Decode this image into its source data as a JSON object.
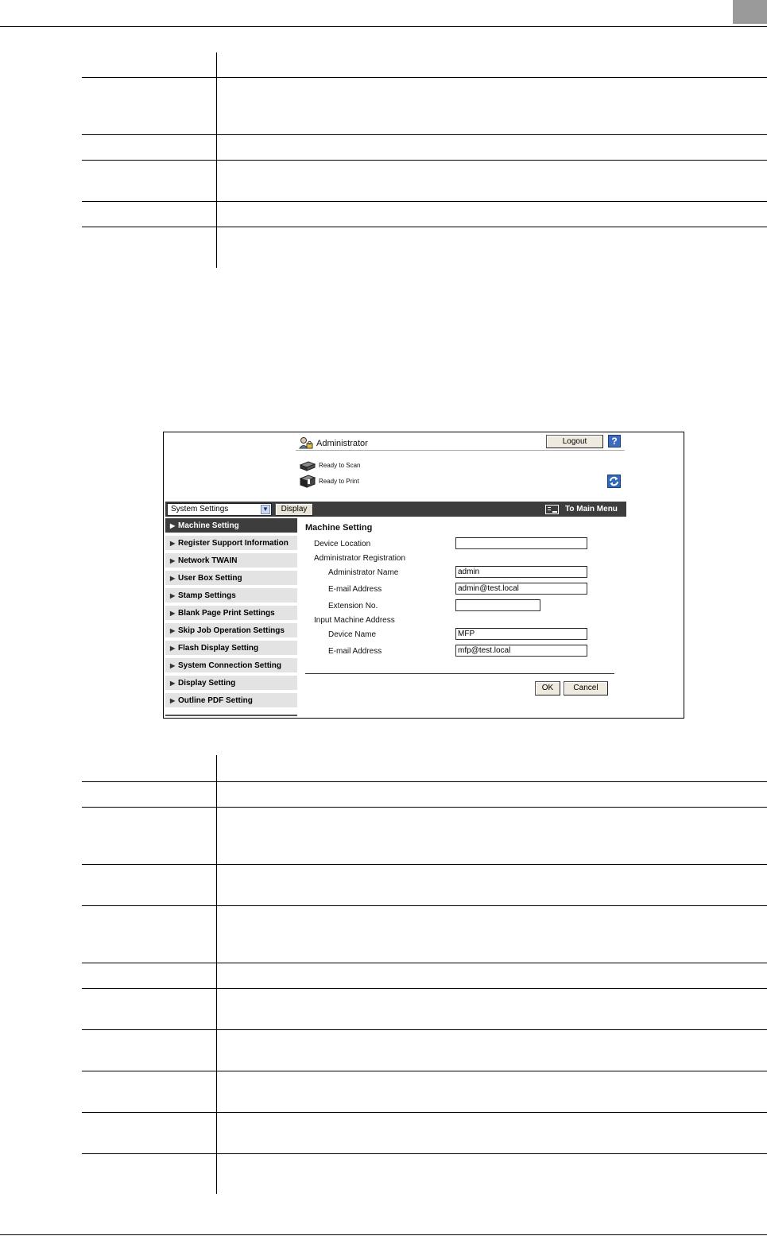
{
  "ui": {
    "user": "Administrator",
    "logout_label": "Logout",
    "help_symbol": "?",
    "status_scan": "Ready to Scan",
    "status_print": "Ready to Print",
    "menu_select_value": "System Settings",
    "display_label": "Display",
    "to_main_menu": "To Main Menu",
    "sidebar": [
      {
        "label": "Machine Setting",
        "active": true
      },
      {
        "label": "Register Support Information"
      },
      {
        "label": "Network TWAIN"
      },
      {
        "label": "User Box Setting"
      },
      {
        "label": "Stamp Settings"
      },
      {
        "label": "Blank Page Print Settings"
      },
      {
        "label": "Skip Job Operation Settings"
      },
      {
        "label": "Flash Display Setting"
      },
      {
        "label": "System Connection Setting"
      },
      {
        "label": "Display Setting"
      },
      {
        "label": "Outline PDF Setting"
      }
    ],
    "form": {
      "title": "Machine Setting",
      "device_location_label": "Device Location",
      "device_location_value": "",
      "admin_registration_label": "Administrator Registration",
      "admin_name_label": "Administrator Name",
      "admin_name_value": "admin",
      "admin_email_label": "E-mail Address",
      "admin_email_value": "admin@test.local",
      "extension_label": "Extension No.",
      "extension_value": "",
      "input_machine_address_label": "Input Machine Address",
      "device_name_label": "Device Name",
      "device_name_value": "MFP",
      "machine_email_label": "E-mail Address",
      "machine_email_value": "mfp@test.local",
      "ok_label": "OK",
      "cancel_label": "Cancel"
    }
  }
}
